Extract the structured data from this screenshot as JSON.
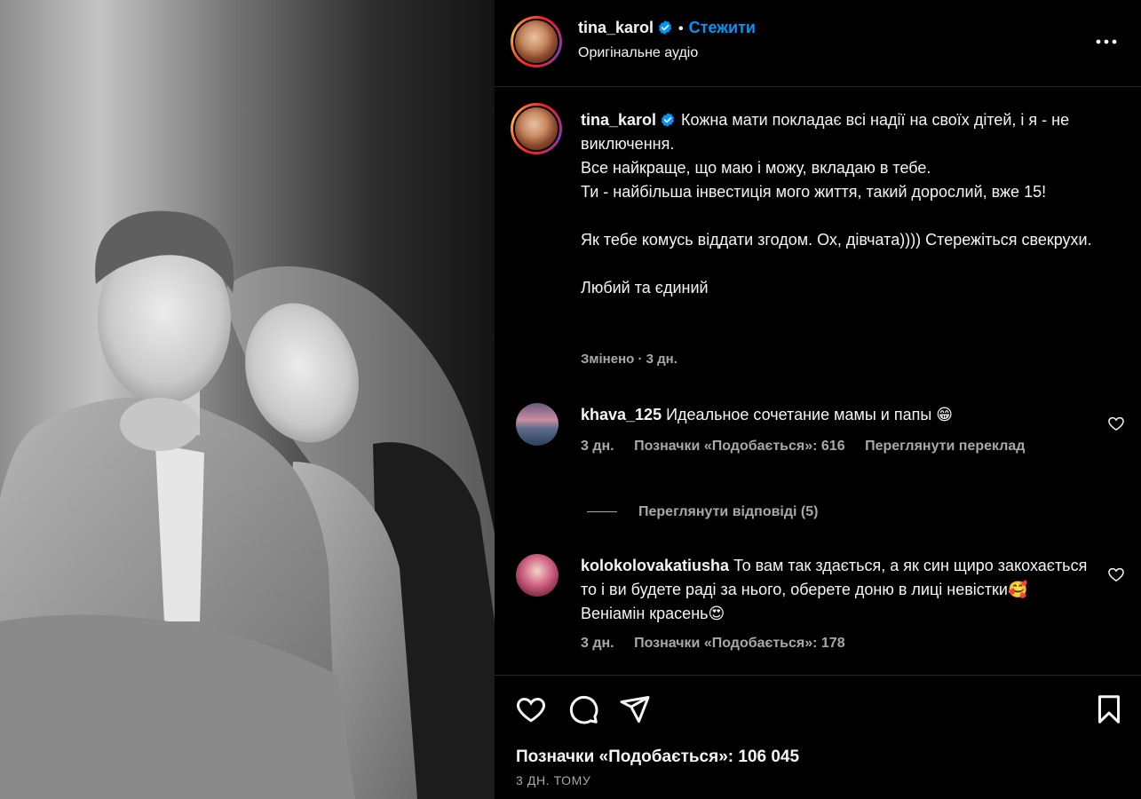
{
  "post": {
    "username": "tina_karol",
    "follow_label": "Стежити",
    "audio_label": "Оригінальне аудіо"
  },
  "caption": {
    "username": "tina_karol",
    "lines": [
      "Кожна мати покладає всі надії на своїх дітей, і я - не виключення.",
      "Все найкраще, що маю і можу, вкладаю в тебе.",
      "Ти - найбільша інвестиція мого життя, такий дорослий, вже 15!",
      "",
      "Як тебе комусь віддати згодом. Ох, дівчата)))) Стережіться свекрухи.",
      "",
      "Любий та єдиний"
    ],
    "meta": "Змінено · 3 дн."
  },
  "comments": [
    {
      "username": "khava_125",
      "text": "Идеальное сочетание мамы и папы 😁",
      "time": "3 дн.",
      "likes": "Позначки «Подобається»: 616",
      "translate": "Переглянути переклад"
    },
    {
      "username": "kolokolovakatiusha",
      "text": "То вам так здається, а як син щиро закохається то і ви будете раді за нього, оберете доню в лиці невістки🥰 Веніамін красень😍",
      "time": "3 дн.",
      "likes": "Позначки «Подобається»: 178"
    }
  ],
  "view_replies": "Переглянути відповіді (5)",
  "footer": {
    "likes": "Позначки «Подобається»: 106 045",
    "time": "3 ДН. ТОМУ"
  },
  "colors": {
    "background": "#000000",
    "text": "#f5f5f5",
    "secondary": "#a8a8a8",
    "link": "#0095f6",
    "verified": "#0095f6",
    "divider": "#262626"
  },
  "icons": [
    "verified-badge-icon",
    "more-options-icon",
    "heart-icon",
    "comment-icon",
    "share-icon",
    "bookmark-icon"
  ]
}
